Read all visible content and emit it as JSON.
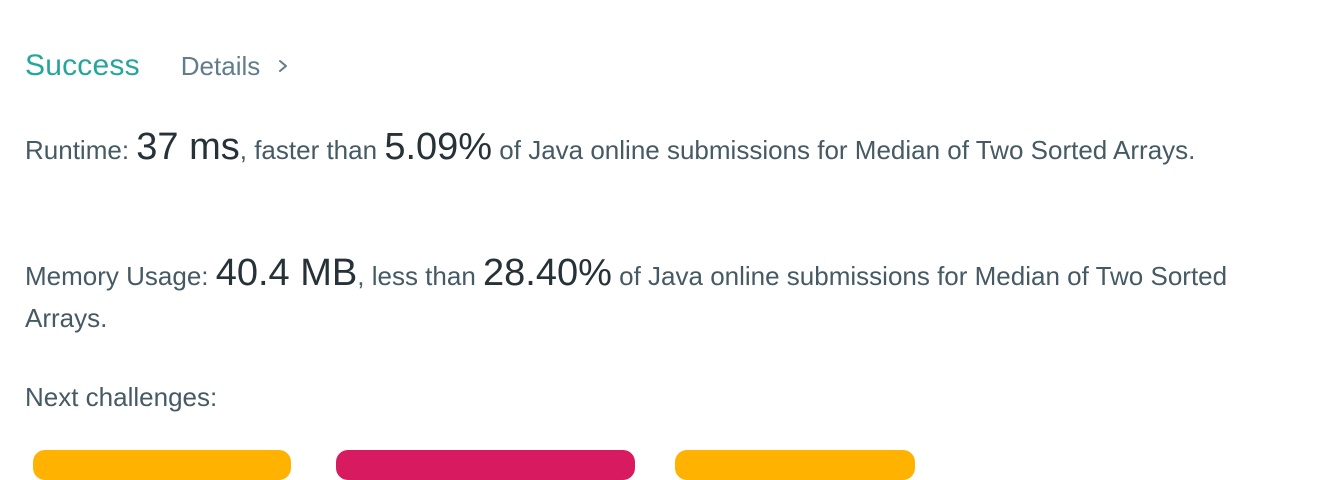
{
  "result": {
    "status": "Success",
    "details_label": "Details"
  },
  "runtime": {
    "label": "Runtime:",
    "value": "37 ms",
    "comparison": ", faster than",
    "percent": "5.09%",
    "suffix": "of Java online submissions for Median of Two Sorted Arrays."
  },
  "memory": {
    "label": "Memory Usage:",
    "value": "40.4 MB",
    "comparison": ", less than",
    "percent": "28.40%",
    "suffix": "of Java online submissions for Median of Two Sorted Arrays."
  },
  "next": {
    "label": "Next challenges:"
  },
  "colors": {
    "success": "#26a69a",
    "chip_medium": "#ffb300",
    "chip_hard": "#d81b60"
  }
}
